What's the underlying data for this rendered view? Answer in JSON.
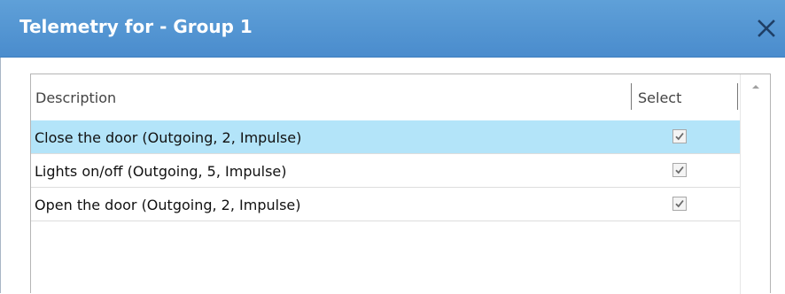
{
  "window": {
    "title": "Telemetry for - Group 1"
  },
  "table": {
    "columns": {
      "description": "Description",
      "select": "Select"
    },
    "rows": [
      {
        "description": "Close the door (Outgoing, 2, Impulse)",
        "selected": true,
        "checked": true
      },
      {
        "description": "Lights on/off (Outgoing, 5, Impulse)",
        "selected": false,
        "checked": true
      },
      {
        "description": "Open the door (Outgoing, 2, Impulse)",
        "selected": false,
        "checked": true
      }
    ]
  },
  "icons": {
    "close": "close-icon",
    "checkbox": "checkmark-icon",
    "scroll_up": "chevron-up-icon"
  },
  "colors": {
    "titlebar": "#5fa0d8",
    "selected_row": "#b3e4f9"
  }
}
